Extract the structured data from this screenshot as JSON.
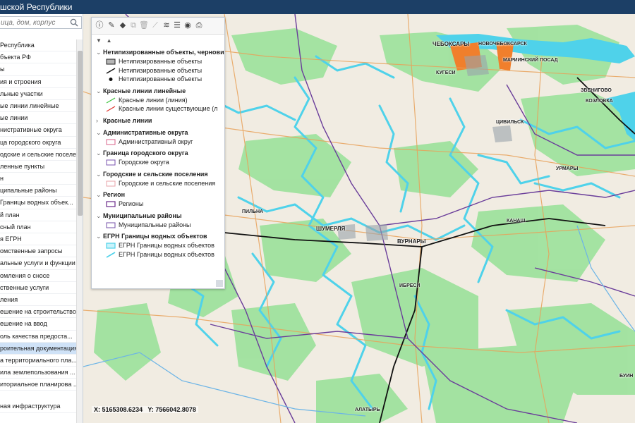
{
  "header": {
    "title": "шской Республики"
  },
  "search": {
    "placeholder": "ица, дом, корпус"
  },
  "sidebar": {
    "items": [
      "Республика",
      "бъекта РФ",
      "ы",
      "ия и строения",
      "льные участки",
      "ые линии линейные",
      "ые линии",
      "нистративные округа",
      "ца городского округа",
      "одские и сельские поселе...",
      "ленные пункты",
      "н",
      "ципальные районы",
      "Границы водных объек...",
      "й план",
      "сный план",
      "я ЕГРН",
      "омственные запросы",
      "альные услуги и функции",
      "омления о сносе",
      "ственные услуги",
      "ления",
      "ешение на строительство",
      "ешение на ввод",
      "оль качества предоста...",
      "роительная документация",
      "а территориального пла...",
      "ила землепользования ...",
      "иториальное планирова ..."
    ],
    "bottom_item": "ная инфраструктура",
    "selected_index": 25
  },
  "layer_panel": {
    "groups": [
      {
        "title": "Нетипизированные объекты, черновик",
        "expanded": true,
        "items": [
          {
            "label": "Нетипизированные объекты",
            "symbol": "polygon-gray"
          },
          {
            "label": "Нетипизированные объекты",
            "symbol": "line-black"
          },
          {
            "label": "Нетипизированные объекты",
            "symbol": "point-black"
          }
        ]
      },
      {
        "title": "Красные линии линейные",
        "expanded": true,
        "items": [
          {
            "label": "Красные линии (линия)",
            "symbol": "line-green"
          },
          {
            "label": "Красные линии существующие (л",
            "symbol": "line-red"
          }
        ]
      },
      {
        "title": "Красные линии",
        "expanded": false,
        "items": []
      },
      {
        "title": "Административные округа",
        "expanded": true,
        "items": [
          {
            "label": "Административный округ",
            "symbol": "box-pink"
          }
        ]
      },
      {
        "title": "Граница городского округа",
        "expanded": true,
        "items": [
          {
            "label": "Городские округа",
            "symbol": "box-purple"
          }
        ]
      },
      {
        "title": "Городские и сельские поселения",
        "expanded": true,
        "items": [
          {
            "label": "Городские и сельские поселения",
            "symbol": "box-lightpink"
          }
        ]
      },
      {
        "title": "Регион",
        "expanded": true,
        "items": [
          {
            "label": "Регионы",
            "symbol": "box-darkpurple"
          }
        ]
      },
      {
        "title": "Муниципальные районы",
        "expanded": true,
        "items": [
          {
            "label": "Муниципальные районы",
            "symbol": "box-purple2"
          }
        ]
      },
      {
        "title": "ЕГРН Границы водных объектов",
        "expanded": true,
        "items": [
          {
            "label": "ЕГРН Границы водных объектов",
            "symbol": "box-cyan"
          },
          {
            "label": "ЕГРН Границы водных объектов",
            "symbol": "line-cyan"
          }
        ]
      }
    ]
  },
  "toolbar_icons": [
    "info-icon",
    "edit-icon",
    "shapes-icon",
    "copy-icon",
    "delete-icon",
    "measure-icon",
    "layers-icon",
    "list-icon",
    "globe-icon",
    "print-icon"
  ],
  "coords": {
    "x_label": "X:",
    "x": "5165308.6234",
    "y_label": "Y:",
    "y": "7566042.8078"
  },
  "map_labels": {
    "cheboksary": "ЧЕБОКСАРЫ",
    "novocheboksarsk": "НОВОЧЕБОКСАРСК",
    "mariinsky_posad": "МАРИИНСКИЙ ПОСАД",
    "zvenigovo": "ЗВЕНИГОВО",
    "kozlovka": "КОЗЛОВКА",
    "tsivilsk": "ЦИВИЛЬСК",
    "vurnary": "ВУРНАРЫ",
    "shumerlya": "ШУМЕРЛЯ",
    "urmary": "УРМАРЫ",
    "kanash": "КАНАШ",
    "alatyr": "АЛАТЫРЬ",
    "kugesi": "КУГЕСИ",
    "ibresi": "ИБРЕСИ",
    "pilna": "ПИЛЬНА",
    "buinsk": "БУИН"
  },
  "colors": {
    "header": "#1c3f66",
    "forest": "#9be29b",
    "water": "#4fd2ea",
    "boundary": "#6a3d9a",
    "road_orange": "#e8a25a",
    "river": "#6cb4e6"
  }
}
